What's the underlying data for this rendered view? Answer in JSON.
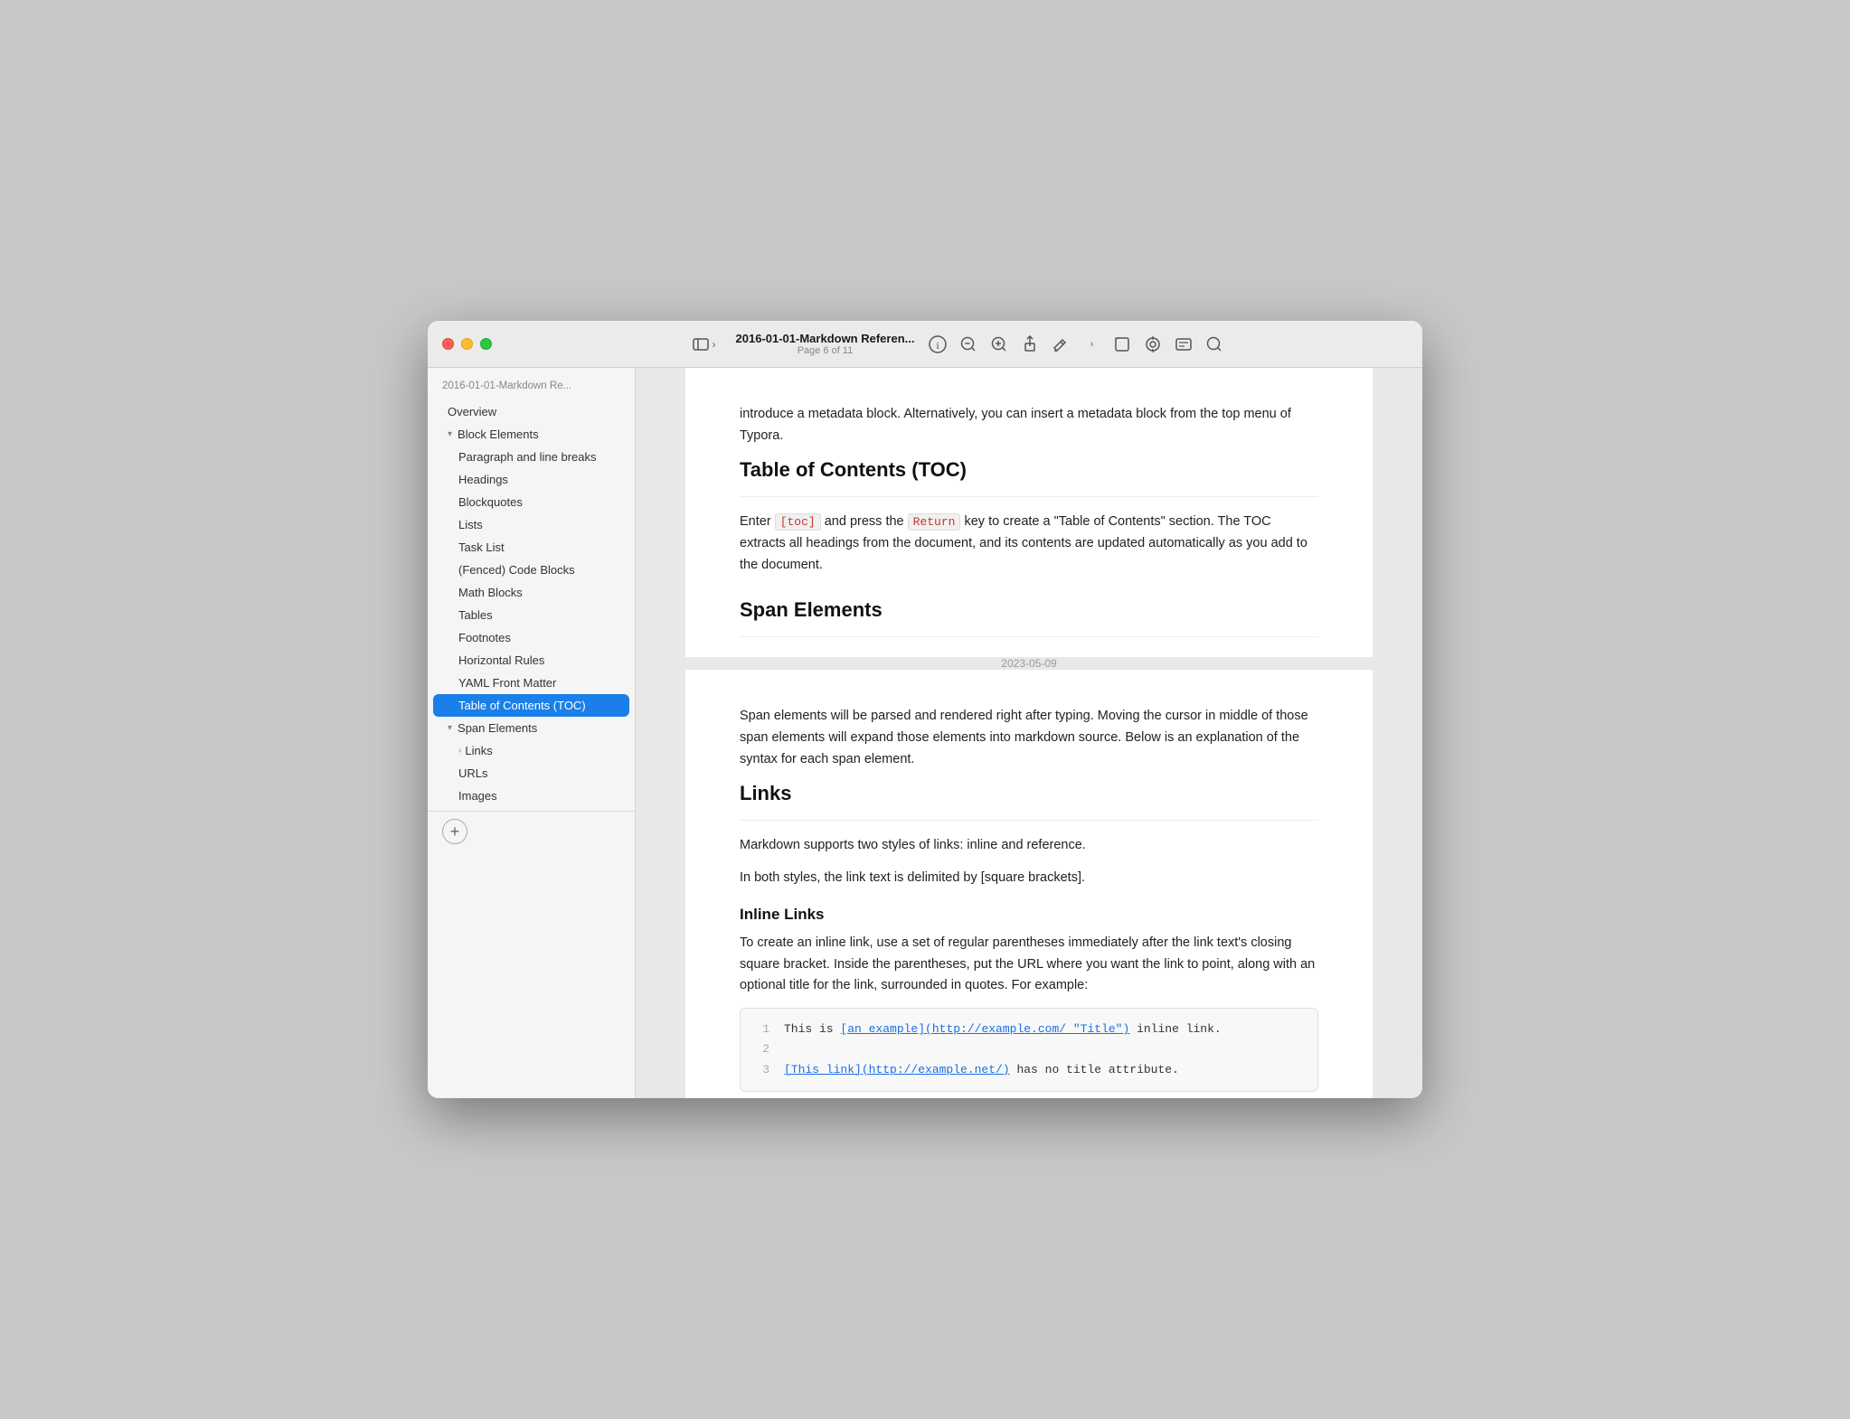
{
  "window": {
    "title": "2016-01-01-Markdown Referen...",
    "page_info": "Page 6 of 11"
  },
  "toolbar": {
    "sidebar_toggle": "sidebar-toggle",
    "chevron_label": "›",
    "info_icon": "ℹ",
    "zoom_out_icon": "−",
    "zoom_in_icon": "+",
    "share_icon": "↑",
    "edit_icon": "✏",
    "chevron_icon": "›",
    "box_icon": "□",
    "target_icon": "◎",
    "annotate_icon": "✏",
    "search_icon": "🔍"
  },
  "sidebar": {
    "doc_name": "2016-01-01-Markdown Re...",
    "overview_label": "Overview",
    "block_elements_label": "Block Elements",
    "items": [
      {
        "label": "Paragraph and line breaks",
        "indent": "child"
      },
      {
        "label": "Headings",
        "indent": "child"
      },
      {
        "label": "Blockquotes",
        "indent": "child"
      },
      {
        "label": "Lists",
        "indent": "child"
      },
      {
        "label": "Task List",
        "indent": "child"
      },
      {
        "label": "(Fenced) Code Blocks",
        "indent": "child"
      },
      {
        "label": "Math Blocks",
        "indent": "child"
      },
      {
        "label": "Tables",
        "indent": "child"
      },
      {
        "label": "Footnotes",
        "indent": "child"
      },
      {
        "label": "Horizontal Rules",
        "indent": "child"
      },
      {
        "label": "YAML Front Matter",
        "indent": "child"
      },
      {
        "label": "Table of Contents (TOC)",
        "indent": "child",
        "active": true
      }
    ],
    "span_elements_label": "Span Elements",
    "span_children": [
      {
        "label": "Links",
        "has_children": true
      },
      {
        "label": "URLs"
      },
      {
        "label": "Images"
      }
    ],
    "add_button": "+"
  },
  "page1": {
    "intro_text": "introduce a metadata block. Alternatively, you can insert a metadata block from the top menu of Typora.",
    "toc_heading": "Table of Contents (TOC)",
    "toc_para": "Enter",
    "toc_code1": "[toc]",
    "toc_and": " and press the ",
    "toc_code2": "Return",
    "toc_rest": " key to create a  \"Table of Contents\" section. The TOC extracts all headings from the document, and its contents are updated automatically as you add to the document.",
    "span_elements_heading": "Span Elements"
  },
  "page_date": "2023-05-09",
  "page2": {
    "intro": "Span elements will be parsed and rendered right after typing. Moving the cursor in middle of those span elements will expand those elements into markdown source. Below is an explanation of the syntax for each span element.",
    "links_heading": "Links",
    "links_para1": "Markdown supports two styles of links: inline and reference.",
    "links_para2": "In both styles, the link text is delimited by [square brackets].",
    "inline_links_heading": "Inline Links",
    "inline_links_para": "To create an inline link, use a set of regular parentheses immediately after the link text's closing square bracket. Inside the parentheses, put the URL where you want the link to point, along with an optional title for the link, surrounded in quotes. For example:",
    "code_lines": [
      {
        "num": "1",
        "prefix": "This is ",
        "link_text": "[an example](http://example.com/ \"Title\")",
        "suffix": " inline link."
      },
      {
        "num": "2",
        "prefix": "",
        "link_text": "",
        "suffix": ""
      },
      {
        "num": "3",
        "prefix": "",
        "link_text": "[This link](http://example.net/)",
        "suffix": " has no title attribute."
      }
    ]
  }
}
